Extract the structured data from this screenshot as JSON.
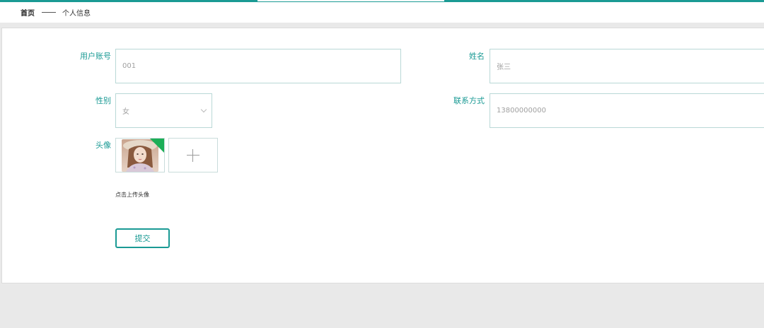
{
  "breadcrumb": {
    "home": "首页",
    "current": "个人信息"
  },
  "form": {
    "account": {
      "label": "用户账号",
      "value": "001"
    },
    "name": {
      "label": "姓名",
      "value": "张三"
    },
    "gender": {
      "label": "性别",
      "value": "女"
    },
    "phone": {
      "label": "联系方式",
      "value": "13800000000"
    },
    "avatar": {
      "label": "头像",
      "hint": "点击上传头像"
    },
    "submit_label": "提交"
  },
  "colors": {
    "accent": "#1a9a94",
    "border": "#b9d8d6",
    "page_bg": "#e9e9e9"
  },
  "icons": [
    "chevron-down-icon",
    "plus-icon",
    "corner-badge-icon"
  ]
}
